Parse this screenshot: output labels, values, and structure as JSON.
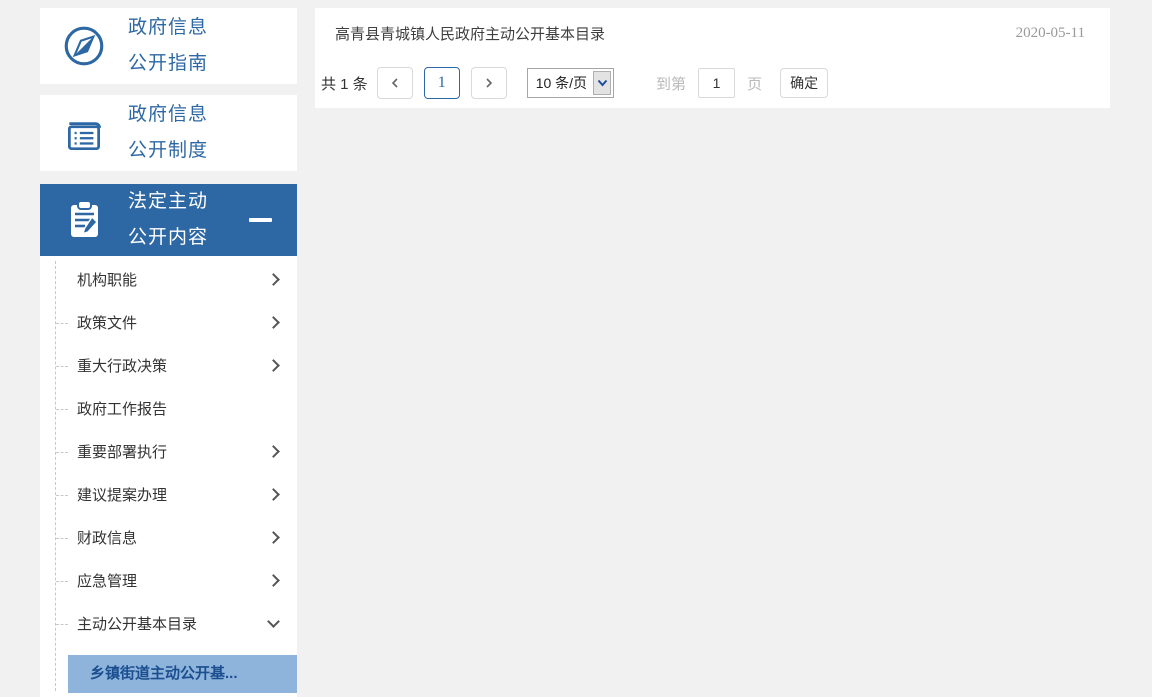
{
  "colors": {
    "accent_blue": "#2d68a4",
    "highlight_bg": "#8fb4dc",
    "highlight_text": "#1b4e8f",
    "page_bg": "#f1f1f1",
    "active_page_border": "#2d68a6"
  },
  "sidebar": {
    "guide": {
      "label_line1": "政府信息",
      "label_line2": "公开指南",
      "icon": "compass-icon"
    },
    "system": {
      "label_line1": "政府信息",
      "label_line2": "公开制度",
      "icon": "book-icon"
    },
    "legal": {
      "label_line1": "法定主动",
      "label_line2": "公开内容",
      "icon": "clipboard-pencil-icon",
      "collapse_indicator": "minus"
    },
    "submenu": [
      {
        "label": "机构职能",
        "chevron": "right"
      },
      {
        "label": "政策文件",
        "chevron": "right"
      },
      {
        "label": "重大行政决策",
        "chevron": "right"
      },
      {
        "label": "政府工作报告",
        "chevron": "none"
      },
      {
        "label": "重要部署执行",
        "chevron": "right"
      },
      {
        "label": "建议提案办理",
        "chevron": "right"
      },
      {
        "label": "财政信息",
        "chevron": "right"
      },
      {
        "label": "应急管理",
        "chevron": "right"
      },
      {
        "label": "主动公开基本目录",
        "chevron": "down"
      }
    ],
    "active_child": {
      "label": "乡镇街道主动公开基..."
    }
  },
  "main": {
    "list_item": {
      "title": "高青县青城镇人民政府主动公开基本目录",
      "date": "2020-05-11"
    },
    "pagination": {
      "total_text": "共 1 条",
      "current_page": "1",
      "page_size": "10 条/页",
      "goto_prefix": "到第",
      "goto_value": "1",
      "goto_suffix": "页",
      "confirm_label": "确定"
    }
  }
}
